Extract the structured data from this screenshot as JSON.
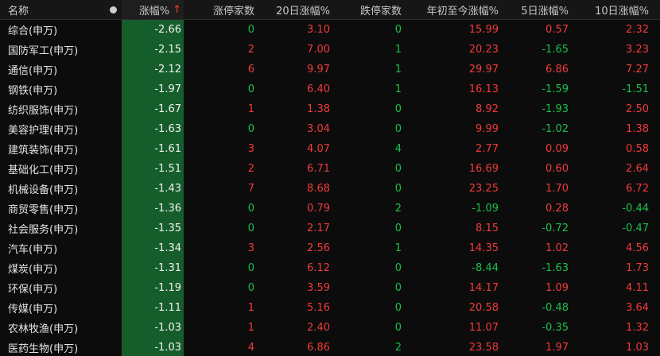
{
  "header": {
    "name": "名称",
    "chg": "涨幅%",
    "chg_arrow": "↑",
    "limit_up": "涨停家数",
    "chg20": "20日涨幅%",
    "limit_down": "跌停家数",
    "ytd": "年初至今涨幅%",
    "chg5": "5日涨幅%",
    "chg10": "10日涨幅%"
  },
  "colors": {
    "up": "#f23a3a",
    "down": "#19c24a",
    "sort_column_bg": "#155e2b"
  },
  "rows": [
    {
      "name": "综合(申万)",
      "chg": "-2.66",
      "limit_up": "0",
      "chg20": "3.10",
      "limit_down": "0",
      "ytd": "15.99",
      "chg5": "0.57",
      "chg10": "2.32"
    },
    {
      "name": "国防军工(申万)",
      "chg": "-2.15",
      "limit_up": "2",
      "chg20": "7.00",
      "limit_down": "1",
      "ytd": "20.23",
      "chg5": "-1.65",
      "chg10": "3.23"
    },
    {
      "name": "通信(申万)",
      "chg": "-2.12",
      "limit_up": "6",
      "chg20": "9.97",
      "limit_down": "1",
      "ytd": "29.97",
      "chg5": "6.86",
      "chg10": "7.27"
    },
    {
      "name": "钢铁(申万)",
      "chg": "-1.97",
      "limit_up": "0",
      "chg20": "6.40",
      "limit_down": "1",
      "ytd": "16.13",
      "chg5": "-1.59",
      "chg10": "-1.51"
    },
    {
      "name": "纺织服饰(申万)",
      "chg": "-1.67",
      "limit_up": "1",
      "chg20": "1.38",
      "limit_down": "0",
      "ytd": "8.92",
      "chg5": "-1.93",
      "chg10": "2.50"
    },
    {
      "name": "美容护理(申万)",
      "chg": "-1.63",
      "limit_up": "0",
      "chg20": "3.04",
      "limit_down": "0",
      "ytd": "9.99",
      "chg5": "-1.02",
      "chg10": "1.38"
    },
    {
      "name": "建筑装饰(申万)",
      "chg": "-1.61",
      "limit_up": "3",
      "chg20": "4.07",
      "limit_down": "4",
      "ytd": "2.77",
      "chg5": "0.09",
      "chg10": "0.58"
    },
    {
      "name": "基础化工(申万)",
      "chg": "-1.51",
      "limit_up": "2",
      "chg20": "6.71",
      "limit_down": "0",
      "ytd": "16.69",
      "chg5": "0.60",
      "chg10": "2.64"
    },
    {
      "name": "机械设备(申万)",
      "chg": "-1.43",
      "limit_up": "7",
      "chg20": "8.68",
      "limit_down": "0",
      "ytd": "23.25",
      "chg5": "1.70",
      "chg10": "6.72"
    },
    {
      "name": "商贸零售(申万)",
      "chg": "-1.36",
      "limit_up": "0",
      "chg20": "0.79",
      "limit_down": "2",
      "ytd": "-1.09",
      "chg5": "0.28",
      "chg10": "-0.44"
    },
    {
      "name": "社会服务(申万)",
      "chg": "-1.35",
      "limit_up": "0",
      "chg20": "2.17",
      "limit_down": "0",
      "ytd": "8.15",
      "chg5": "-0.72",
      "chg10": "-0.47"
    },
    {
      "name": "汽车(申万)",
      "chg": "-1.34",
      "limit_up": "3",
      "chg20": "2.56",
      "limit_down": "1",
      "ytd": "14.35",
      "chg5": "1.02",
      "chg10": "4.56"
    },
    {
      "name": "煤炭(申万)",
      "chg": "-1.31",
      "limit_up": "0",
      "chg20": "6.12",
      "limit_down": "0",
      "ytd": "-8.44",
      "chg5": "-1.63",
      "chg10": "1.73"
    },
    {
      "name": "环保(申万)",
      "chg": "-1.19",
      "limit_up": "0",
      "chg20": "3.59",
      "limit_down": "0",
      "ytd": "14.17",
      "chg5": "1.09",
      "chg10": "4.11"
    },
    {
      "name": "传媒(申万)",
      "chg": "-1.11",
      "limit_up": "1",
      "chg20": "5.16",
      "limit_down": "0",
      "ytd": "20.58",
      "chg5": "-0.48",
      "chg10": "3.64"
    },
    {
      "name": "农林牧渔(申万)",
      "chg": "-1.03",
      "limit_up": "1",
      "chg20": "2.40",
      "limit_down": "0",
      "ytd": "11.07",
      "chg5": "-0.35",
      "chg10": "1.32"
    },
    {
      "name": "医药生物(申万)",
      "chg": "-1.03",
      "limit_up": "4",
      "chg20": "6.86",
      "limit_down": "2",
      "ytd": "23.58",
      "chg5": "1.97",
      "chg10": "1.03"
    }
  ]
}
